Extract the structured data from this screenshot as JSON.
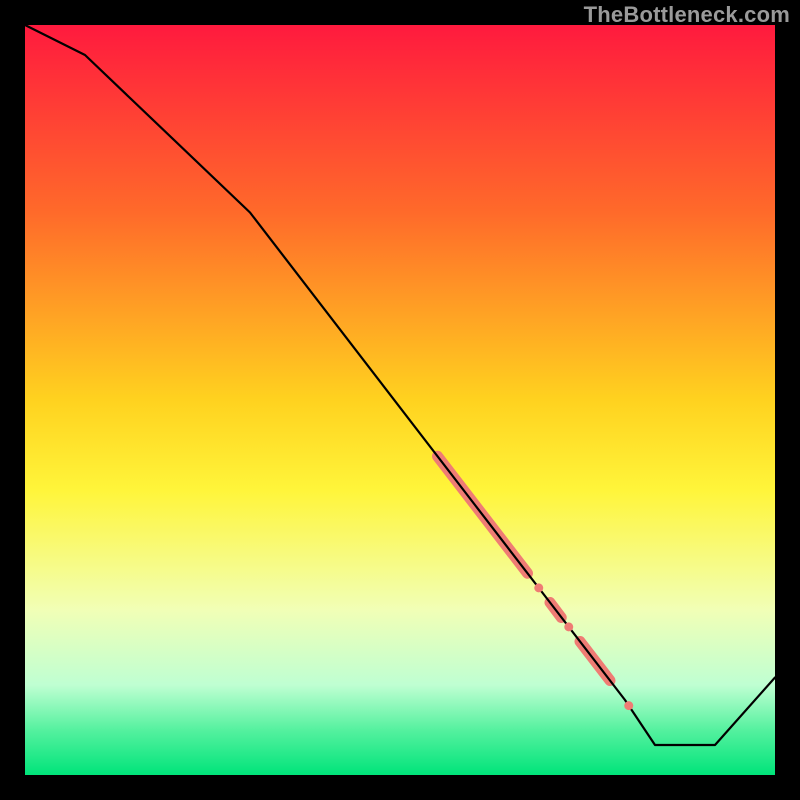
{
  "watermark": "TheBottleneck.com",
  "chart_data": {
    "type": "line",
    "title": "",
    "xlabel": "",
    "ylabel": "",
    "xlim": [
      0,
      100
    ],
    "ylim": [
      0,
      100
    ],
    "gradient_stops": [
      {
        "offset": 0,
        "color": "#ff1a3e"
      },
      {
        "offset": 0.25,
        "color": "#ff6a2a"
      },
      {
        "offset": 0.5,
        "color": "#ffd21f"
      },
      {
        "offset": 0.62,
        "color": "#fff53a"
      },
      {
        "offset": 0.78,
        "color": "#f1ffb6"
      },
      {
        "offset": 0.88,
        "color": "#bfffd2"
      },
      {
        "offset": 0.94,
        "color": "#55f19f"
      },
      {
        "offset": 1.0,
        "color": "#00e47a"
      }
    ],
    "series": [
      {
        "name": "bottleneck-curve",
        "x": [
          0,
          8,
          30,
          60,
          70,
          80,
          84,
          92,
          100
        ],
        "y": [
          100,
          96,
          75,
          36,
          23,
          10,
          4,
          4,
          13
        ]
      }
    ],
    "highlight_segments": [
      {
        "x0": 55,
        "y0": 42.5,
        "x1": 67,
        "y1": 26.9
      },
      {
        "x0": 70,
        "y0": 23.0,
        "x1": 71.5,
        "y1": 21.0
      },
      {
        "x0": 74,
        "y0": 17.8,
        "x1": 78,
        "y1": 12.6
      }
    ],
    "highlight_dots": [
      {
        "x": 68.5,
        "y": 24.95
      },
      {
        "x": 72.5,
        "y": 19.75
      },
      {
        "x": 80.5,
        "y": 9.25
      }
    ]
  }
}
